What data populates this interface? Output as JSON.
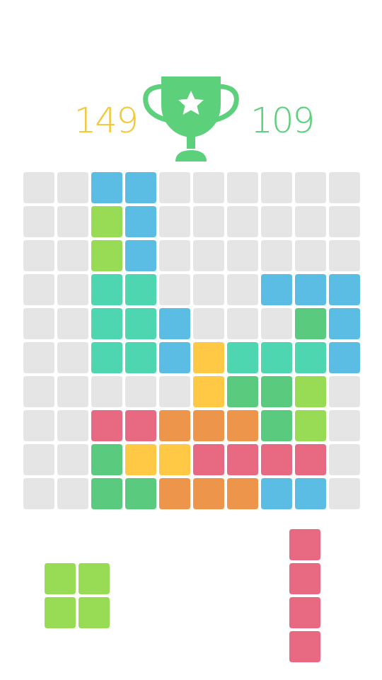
{
  "score": "149",
  "best": "109",
  "grid": [
    [
      null,
      null,
      "#5bbde4",
      "#5bbde4",
      null,
      null,
      null,
      null,
      null,
      null
    ],
    [
      null,
      null,
      "#98dc55",
      "#5bbde4",
      null,
      null,
      null,
      null,
      null,
      null
    ],
    [
      null,
      null,
      "#98dc55",
      "#5bbde4",
      null,
      null,
      null,
      null,
      null,
      null
    ],
    [
      null,
      null,
      "#4dd6b0",
      "#4dd6b0",
      null,
      null,
      null,
      "#5bbde4",
      "#5bbde4",
      "#5bbde4"
    ],
    [
      null,
      null,
      "#4dd6b0",
      "#4dd6b0",
      "#5bbde4",
      null,
      null,
      null,
      "#5acb7e",
      "#5bbde4"
    ],
    [
      null,
      null,
      "#4dd6b0",
      "#4dd6b0",
      "#5bbde4",
      "#ffc845",
      "#4dd6b0",
      "#4dd6b0",
      "#4dd6b0",
      "#5bbde4"
    ],
    [
      null,
      null,
      null,
      null,
      null,
      "#ffc845",
      "#5acb7e",
      "#5acb7e",
      "#98dc55",
      null
    ],
    [
      null,
      null,
      "#e76a82",
      "#e76a82",
      "#ed954a",
      "#ed954a",
      "#ed954a",
      "#5acb7e",
      "#98dc55",
      null
    ],
    [
      null,
      null,
      "#5acb7e",
      "#ffc845",
      "#ffc845",
      "#e76a82",
      "#e76a82",
      "#e76a82",
      "#e76a82",
      null
    ],
    [
      null,
      null,
      "#5acb7e",
      "#5acb7e",
      "#ed954a",
      "#ed954a",
      "#ed954a",
      "#5bbde4",
      "#5bbde4",
      null
    ]
  ],
  "pieces": [
    {
      "color": "#98dc55",
      "shape": [
        [
          1,
          1
        ],
        [
          1,
          1
        ]
      ]
    },
    {
      "color": "#e76a82",
      "shape": [
        [
          1
        ],
        [
          1
        ],
        [
          1
        ],
        [
          1
        ]
      ]
    }
  ]
}
